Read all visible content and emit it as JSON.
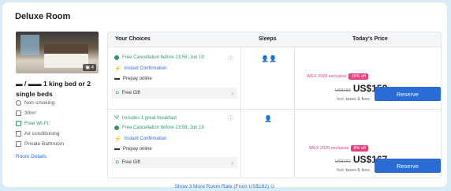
{
  "room": {
    "title": "Deluxe Room",
    "photo_count": "4",
    "bed_type": "1 king bed or 2 single beds",
    "amenities": [
      {
        "label": "Non-smoking",
        "icon": "no-smoking-icon"
      },
      {
        "label": "30m²",
        "icon": "area-icon"
      },
      {
        "label": "Free Wi-Fi",
        "icon": "wifi-icon",
        "color": "#2d9a6b"
      },
      {
        "label": "Air conditioning",
        "icon": "ac-icon"
      },
      {
        "label": "Private Bathroom",
        "icon": "shower-icon"
      }
    ],
    "room_details": "Room Details"
  },
  "table": {
    "headers": {
      "choices": "Your Choices",
      "sleeps": "Sleeps",
      "price": "Today's Price"
    },
    "rows": [
      {
        "choices": [
          {
            "text": "Free Cancellation before 23:59, Jun 19",
            "color": "green"
          },
          {
            "text": "Instant Confirmation",
            "color": "blue"
          },
          {
            "text": "Prepay online",
            "color": "dark"
          }
        ],
        "gift": "Free Gift",
        "sleeps": "2",
        "promo_text": "WEX 2020 exclusive",
        "promo_tag": "16% off",
        "old_price": "US$183",
        "price": "US$152",
        "taxes": "Incl. taxes & fees",
        "reserve": "Reserve"
      },
      {
        "choices": [
          {
            "text": "Includes 1 great breakfast",
            "color": "green"
          },
          {
            "text": "Free Cancellation before 23:59, Jun 19",
            "color": "green"
          },
          {
            "text": "Instant Confirmation",
            "color": "blue"
          },
          {
            "text": "Prepay online",
            "color": "dark"
          }
        ],
        "gift": "Free Gift",
        "sleeps": "1",
        "promo_text": "WEX 2020 exclusive",
        "promo_tag": "8% off",
        "old_price": "US$182",
        "price": "US$167",
        "taxes": "Incl. taxes & fees",
        "reserve": "Reserve"
      }
    ]
  },
  "show_more": "Show 3 More Room Rate (From US$182)",
  "colors": {
    "accent": "#2a6cd6",
    "green": "#2d9a6b",
    "promo": "#e3417f",
    "page_bg": "#d6ecf8"
  }
}
